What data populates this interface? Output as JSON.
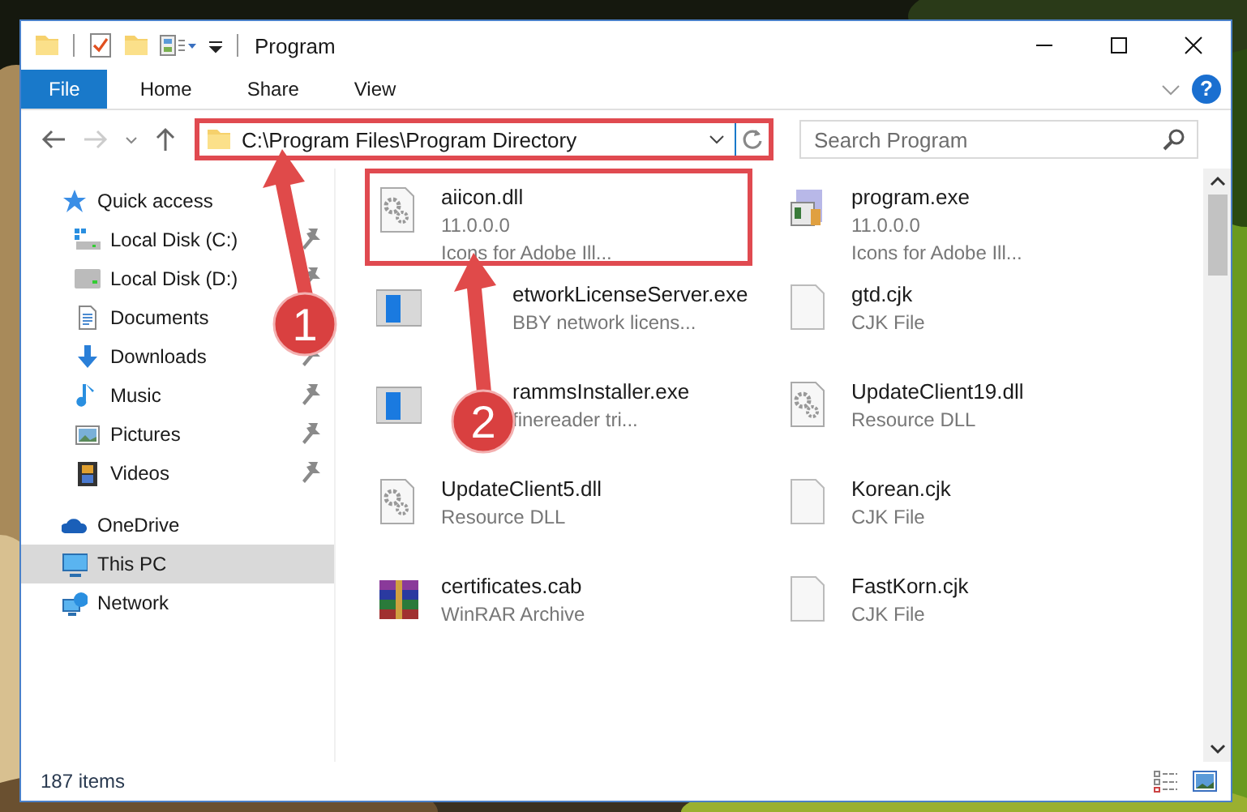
{
  "window": {
    "title": "Program"
  },
  "ribbon_tabs": [
    {
      "label": "File",
      "kind": "file"
    },
    {
      "label": "Home",
      "kind": "tab"
    },
    {
      "label": "Share",
      "kind": "tab"
    },
    {
      "label": "View",
      "kind": "tab"
    }
  ],
  "help_button": {
    "label": "?"
  },
  "address_bar": {
    "value": "C:\\Program Files\\Program Directory",
    "highlighted": true
  },
  "search": {
    "placeholder": "Search Program"
  },
  "sidebar": {
    "items": [
      {
        "label": "Quick access",
        "kind": "star",
        "selected": false,
        "children": [
          {
            "label": "Local Disk (C:)",
            "kind": "disk-c",
            "pinned": true,
            "selected": false
          },
          {
            "label": "Local Disk (D:)",
            "kind": "disk",
            "pinned": true,
            "selected": false
          },
          {
            "label": "Documents",
            "kind": "documents",
            "selected": false
          },
          {
            "label": "Downloads",
            "kind": "downloads",
            "pinned": true,
            "selected": false
          },
          {
            "label": "Music",
            "kind": "music",
            "pinned": true,
            "selected": false
          },
          {
            "label": "Pictures",
            "kind": "pictures",
            "pinned": true,
            "selected": false
          },
          {
            "label": "Videos",
            "kind": "videos",
            "pinned": true,
            "selected": false
          }
        ]
      },
      {
        "label": "OneDrive",
        "kind": "cloud",
        "selected": false
      },
      {
        "label": "This PC",
        "kind": "pc",
        "selected": true
      },
      {
        "label": "Network",
        "kind": "network",
        "selected": false
      }
    ]
  },
  "files": [
    {
      "name": "aiicon.dll",
      "lines": [
        "11.0.0.0",
        "Icons for Adobe Ill..."
      ],
      "kind": "dll",
      "highlighted": true
    },
    {
      "name": "program.exe",
      "lines": [
        "11.0.0.0",
        "Icons for Adobe Ill..."
      ],
      "kind": "setup",
      "highlighted": false
    },
    {
      "name": "etworkLicenseServer.exe",
      "lines": [
        "BBY network licens..."
      ],
      "kind": "app",
      "highlighted": false,
      "partly_covered": true
    },
    {
      "name": "gtd.cjk",
      "lines": [
        "CJK File"
      ],
      "kind": "blank",
      "highlighted": false
    },
    {
      "name": "rammsInstaller.exe",
      "lines": [
        "finereader tri..."
      ],
      "kind": "app",
      "highlighted": false,
      "partly_covered": true
    },
    {
      "name": "UpdateClient19.dll",
      "lines": [
        "Resource DLL"
      ],
      "kind": "dll",
      "highlighted": false
    },
    {
      "name": "UpdateClient5.dll",
      "lines": [
        "Resource DLL"
      ],
      "kind": "dll",
      "highlighted": false
    },
    {
      "name": "Korean.cjk",
      "lines": [
        "CJK File"
      ],
      "kind": "blank",
      "highlighted": false
    },
    {
      "name": "certificates.cab",
      "lines": [
        "WinRAR Archive"
      ],
      "kind": "archive",
      "highlighted": false
    },
    {
      "name": "FastKorn.cjk",
      "lines": [
        "CJK File"
      ],
      "kind": "blank",
      "highlighted": false
    }
  ],
  "status_bar": {
    "text": "187 items"
  },
  "annotations": [
    {
      "label": "1"
    },
    {
      "label": "2"
    }
  ]
}
